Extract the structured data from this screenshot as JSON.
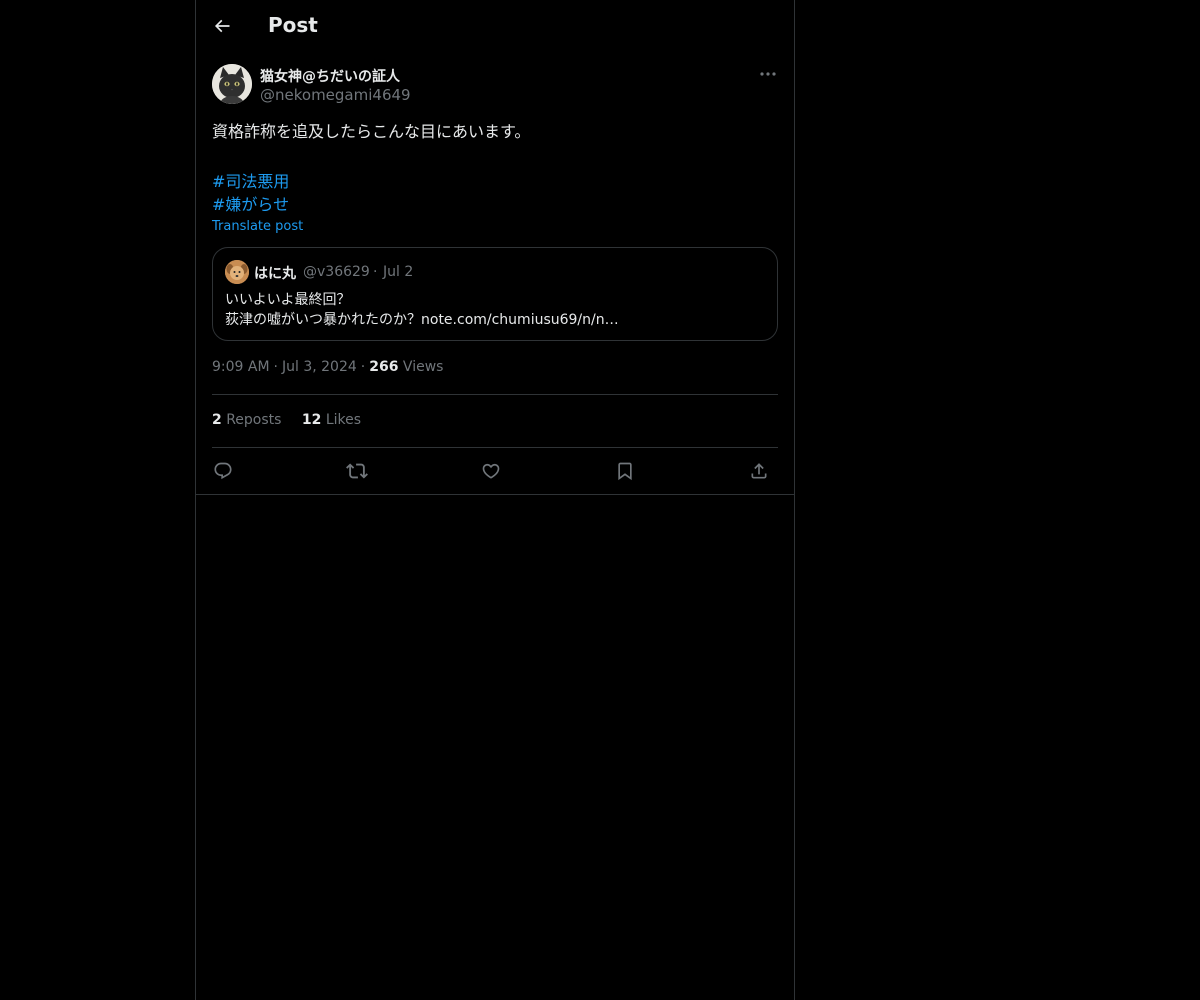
{
  "header": {
    "title": "Post",
    "back_icon": "arrow-left-icon"
  },
  "post": {
    "author": {
      "display_name": "猫女神@ちだいの証人",
      "handle": "@nekomegami4649",
      "avatar_icon": "cat-avatar"
    },
    "text": "資格詐称を追及したらこんな目にあいます。",
    "hashtags": [
      "#司法悪用",
      "#嫌がらせ"
    ],
    "translate_label": "Translate post",
    "quote": {
      "display_name": "はに丸",
      "handle": "@v36629",
      "separator": "·",
      "date": "Jul 2",
      "lines": [
        "いいよいよ最終回？",
        "荻津の嘘がいつ暴かれたのか？note.com/chumiusu69/n/n…"
      ]
    },
    "time": "9:09 AM",
    "date": "Jul 3, 2024",
    "separator": "·",
    "views_count": "266",
    "views_label": "Views",
    "reposts_count": "2",
    "reposts_label": "Reposts",
    "likes_count": "12",
    "likes_label": "Likes"
  },
  "actions": [
    "reply-icon",
    "repost-icon",
    "like-icon",
    "bookmark-icon",
    "share-icon"
  ],
  "colors": {
    "background": "#000000",
    "text": "#e7e9ea",
    "muted": "#71767b",
    "accent": "#1d9bf0",
    "border": "#2f3336"
  }
}
